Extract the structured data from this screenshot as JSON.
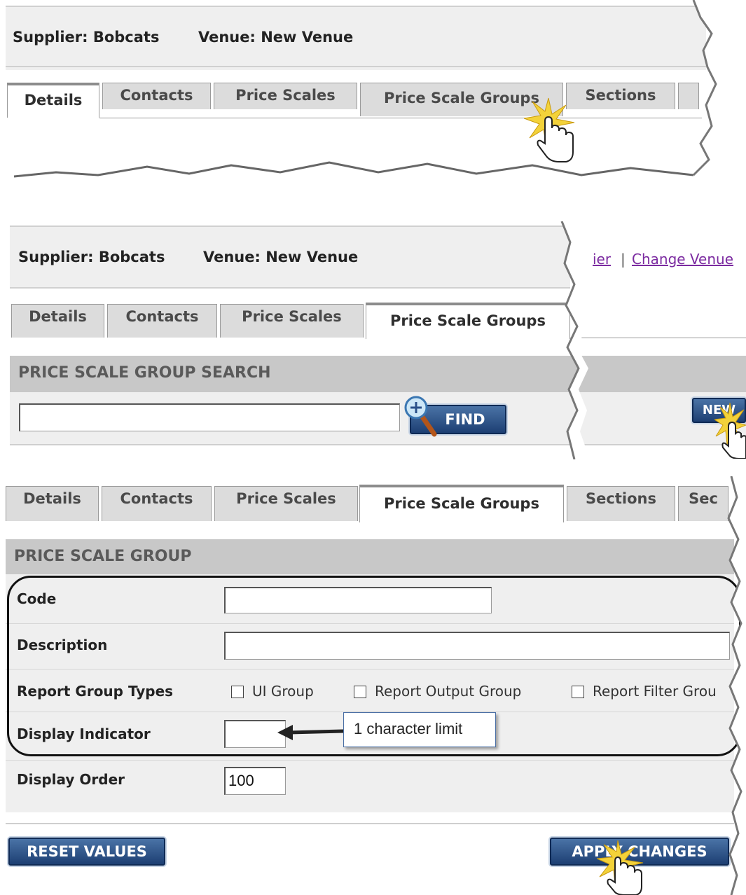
{
  "panel1": {
    "supplier": "Supplier: Bobcats",
    "venue": "Venue: New Venue",
    "tabs": [
      "Details",
      "Contacts",
      "Price Scales",
      "Price Scale Groups",
      "Sections"
    ]
  },
  "panel2": {
    "supplier": "Supplier: Bobcats",
    "venue": "Venue: New Venue",
    "link_partial": "ier",
    "link_sep": "|",
    "change_venue": "Change Venue",
    "tabs": [
      "Details",
      "Contacts",
      "Price Scales",
      "Price Scale Groups"
    ],
    "search_title": "PRICE SCALE GROUP SEARCH",
    "find_label": "FIND",
    "new_label": "NEW"
  },
  "panel3": {
    "tabs": [
      "Details",
      "Contacts",
      "Price Scales",
      "Price Scale Groups",
      "Sections",
      "Sec"
    ],
    "form_title": "PRICE SCALE GROUP",
    "code_label": "Code",
    "description_label": "Description",
    "report_group_types_label": "Report Group Types",
    "checkboxes": [
      "UI Group",
      "Report Output Group",
      "Report Filter Grou"
    ],
    "display_indicator_label": "Display Indicator",
    "callout": "1 character limit",
    "display_order_label": "Display Order",
    "display_order_value": "100",
    "reset_label": "RESET VALUES",
    "apply_label": "APPLY CHANGES"
  },
  "colors": {
    "button": "#2b5089",
    "section_bar": "#c8c8c8",
    "panel": "#efefef",
    "link": "#7b2aa0"
  }
}
